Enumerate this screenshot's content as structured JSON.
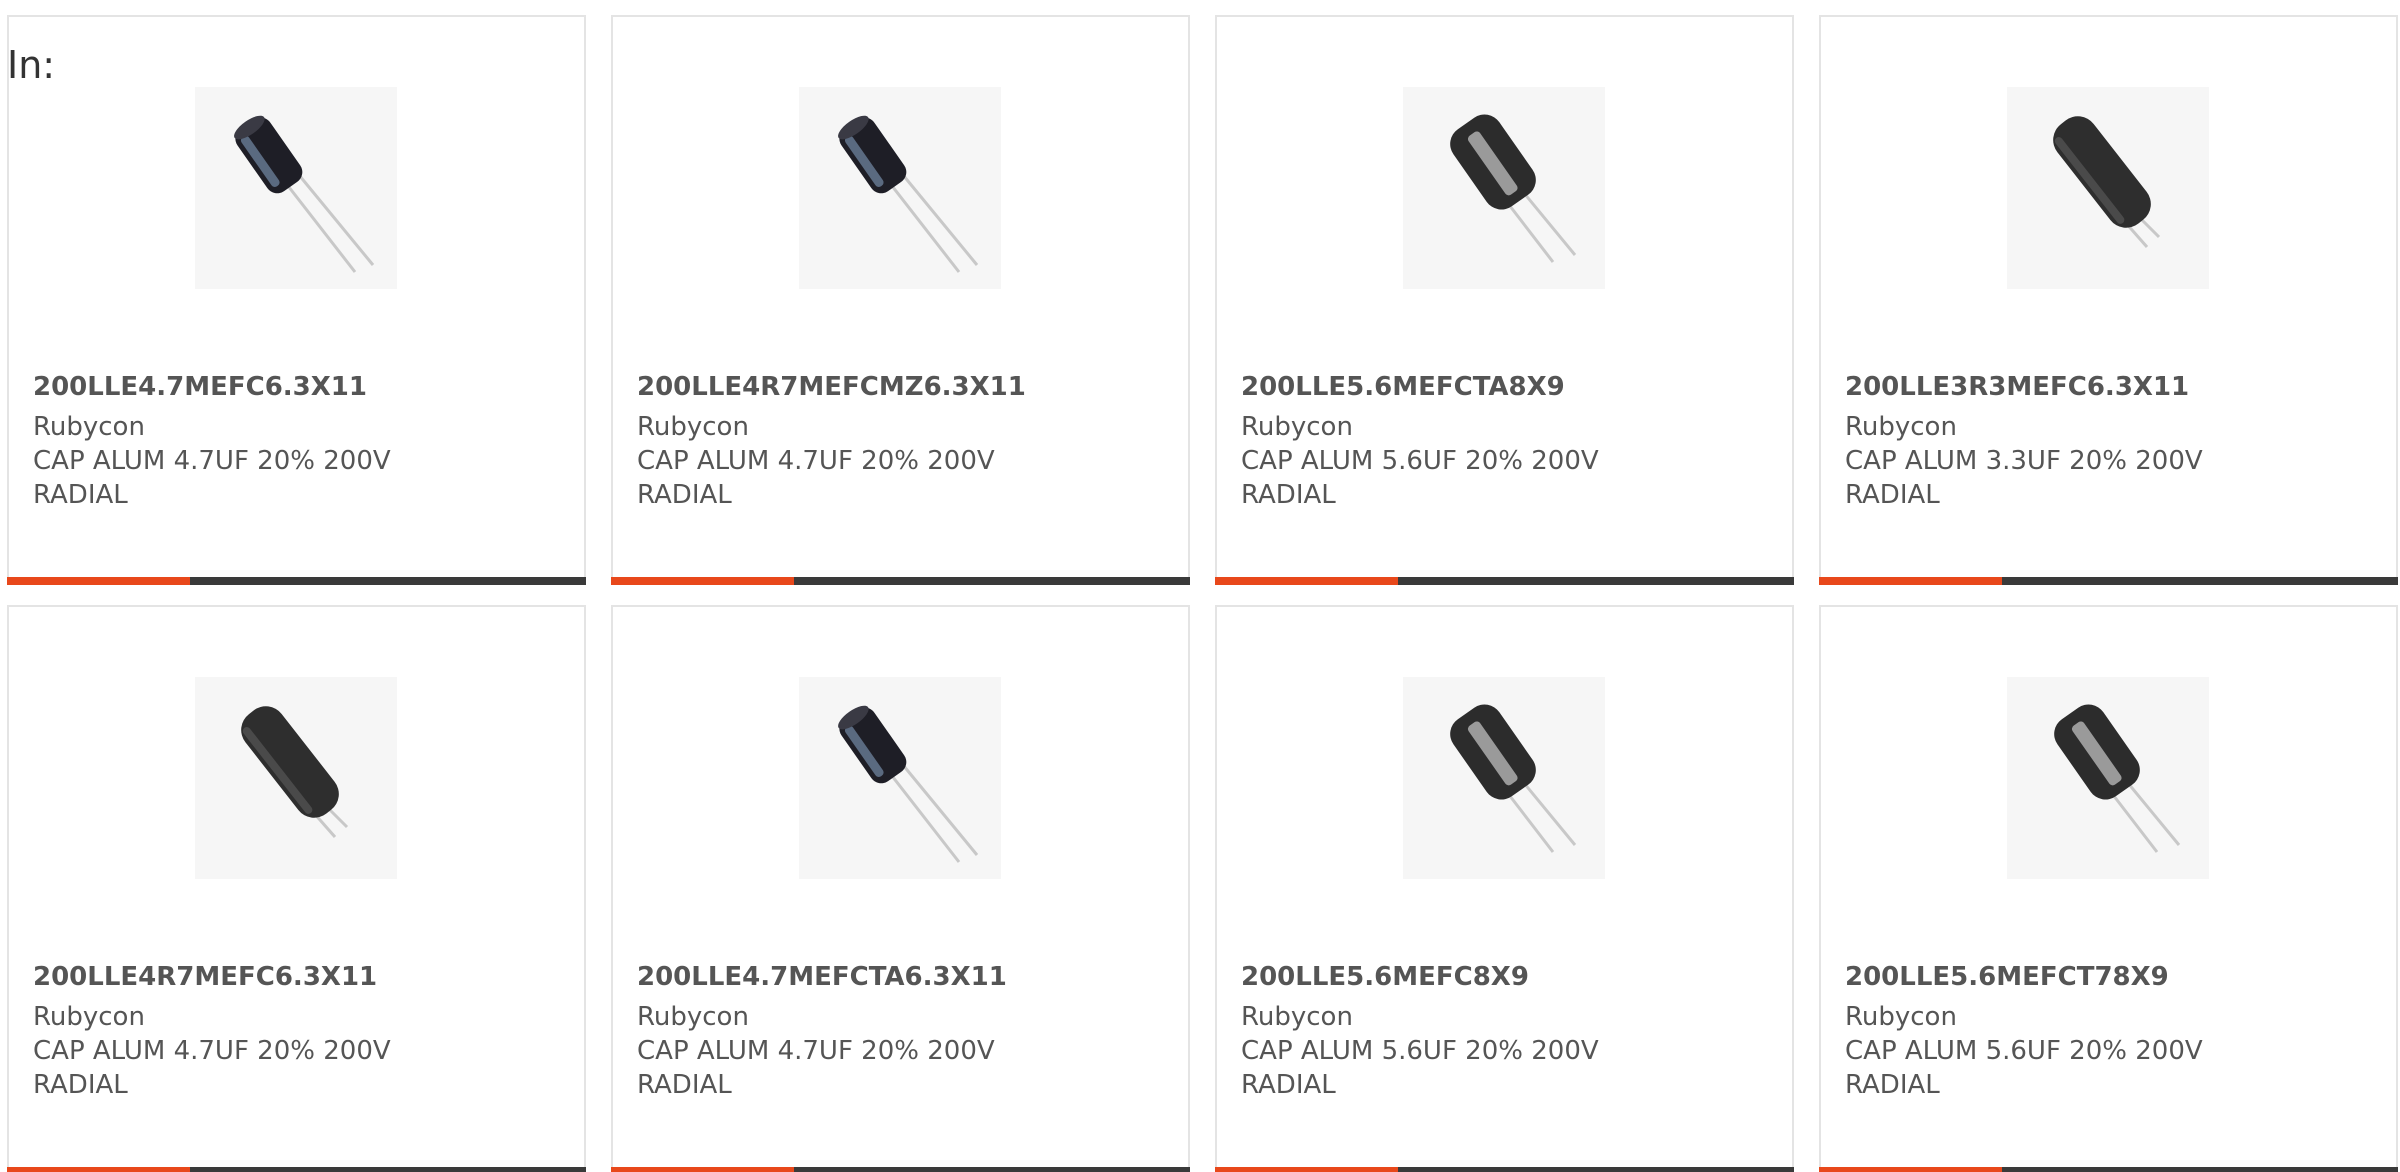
{
  "header": {
    "label": "In:"
  },
  "colors": {
    "accent": "#e8481b",
    "bar": "#3a3a3a",
    "border": "#e4e4e4",
    "text": "#555555"
  },
  "products": [
    {
      "part": "200LLE4.7MEFC6.3X11",
      "manufacturer": "Rubycon",
      "description": "CAP ALUM 4.7UF 20% 200V RADIAL",
      "image": "small-capacitor-icon"
    },
    {
      "part": "200LLE4R7MEFCMZ6.3X11",
      "manufacturer": "Rubycon",
      "description": "CAP ALUM 4.7UF 20% 200V RADIAL",
      "image": "small-capacitor-icon"
    },
    {
      "part": "200LLE5.6MEFCTA8X9",
      "manufacturer": "Rubycon",
      "description": "CAP ALUM 5.6UF 20% 200V RADIAL",
      "image": "wide-capacitor-icon"
    },
    {
      "part": "200LLE3R3MEFC6.3X11",
      "manufacturer": "Rubycon",
      "description": "CAP ALUM 3.3UF 20% 200V RADIAL",
      "image": "tall-capacitor-icon"
    },
    {
      "part": "200LLE4R7MEFC6.3X11",
      "manufacturer": "Rubycon",
      "description": "CAP ALUM 4.7UF 20% 200V RADIAL",
      "image": "tall-capacitor-icon"
    },
    {
      "part": "200LLE4.7MEFCTA6.3X11",
      "manufacturer": "Rubycon",
      "description": "CAP ALUM 4.7UF 20% 200V RADIAL",
      "image": "small-capacitor-icon"
    },
    {
      "part": "200LLE5.6MEFC8X9",
      "manufacturer": "Rubycon",
      "description": "CAP ALUM 5.6UF 20% 200V RADIAL",
      "image": "wide-capacitor-icon"
    },
    {
      "part": "200LLE5.6MEFCT78X9",
      "manufacturer": "Rubycon",
      "description": "CAP ALUM 5.6UF 20% 200V RADIAL",
      "image": "wide-capacitor-icon"
    }
  ]
}
